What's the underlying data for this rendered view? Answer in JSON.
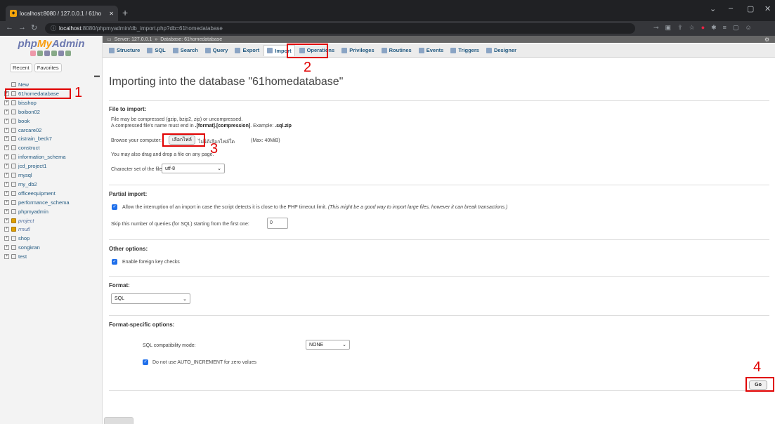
{
  "browser": {
    "tab_title": "localhost:8080 / 127.0.0.1 / 61ho",
    "new_tab": "+",
    "url_host": "localhost",
    "url_rest": ":8080/phpmyadmin/db_import.php?db=61homedatabase",
    "window_controls": [
      "⌄",
      "–",
      "▢",
      "✕"
    ]
  },
  "sidebar": {
    "logo_php": "php",
    "logo_my": "My",
    "logo_admin": "Admin",
    "recent": "Recent",
    "favorites": "Favorites",
    "databases": [
      {
        "name": "New",
        "italic": false
      },
      {
        "name": "61homedatabase",
        "italic": false
      },
      {
        "name": "bisshop",
        "italic": false
      },
      {
        "name": "boibon02",
        "italic": false
      },
      {
        "name": "book",
        "italic": false
      },
      {
        "name": "carcare02",
        "italic": false
      },
      {
        "name": "cistrain_beck7",
        "italic": false
      },
      {
        "name": "construct",
        "italic": false
      },
      {
        "name": "information_schema",
        "italic": false
      },
      {
        "name": "jcd_project1",
        "italic": false
      },
      {
        "name": "mysql",
        "italic": false
      },
      {
        "name": "my_db2",
        "italic": false
      },
      {
        "name": "officeequipment",
        "italic": false
      },
      {
        "name": "performance_schema",
        "italic": false
      },
      {
        "name": "phpmyadmin",
        "italic": false
      },
      {
        "name": "project",
        "italic": true
      },
      {
        "name": "rmutl",
        "italic": true
      },
      {
        "name": "shop",
        "italic": false
      },
      {
        "name": "songkran",
        "italic": false
      },
      {
        "name": "test",
        "italic": false
      }
    ]
  },
  "breadcrumb": {
    "server": "Server: 127.0.0.1",
    "sep": "»",
    "database": "Database: 61homedatabase"
  },
  "tabs": [
    {
      "label": "Structure",
      "active": false
    },
    {
      "label": "SQL",
      "active": false
    },
    {
      "label": "Search",
      "active": false
    },
    {
      "label": "Query",
      "active": false
    },
    {
      "label": "Export",
      "active": false
    },
    {
      "label": "Import",
      "active": true
    },
    {
      "label": "Operations",
      "active": false
    },
    {
      "label": "Privileges",
      "active": false
    },
    {
      "label": "Routines",
      "active": false
    },
    {
      "label": "Events",
      "active": false
    },
    {
      "label": "Triggers",
      "active": false
    },
    {
      "label": "Designer",
      "active": false
    }
  ],
  "main": {
    "title": "Importing into the database \"61homedatabase\"",
    "file_section": {
      "heading": "File to import:",
      "line1": "File may be compressed (gzip, bzip2, zip) or uncompressed.",
      "line2_a": "A compressed file's name must end in ",
      "line2_b": ".[format].[compression]",
      "line2_c": ". Example: ",
      "line2_d": ".sql.zip",
      "browse_label": "Browse your computer:",
      "choose_file_button": "เลือกไฟล์",
      "no_file_text": "ไม่ได้เลือกไฟล์ใด",
      "max_size": "(Max: 40MiB)",
      "drag_text": "You may also drag and drop a file on any page.",
      "charset_label": "Character set of the file:",
      "charset_value": "utf-8"
    },
    "partial_section": {
      "heading": "Partial import:",
      "allow_text": "Allow the interruption of an import in case the script detects it is close to the PHP timeout limit.",
      "allow_note": "(This might be a good way to import large files, however it can break transactions.)",
      "skip_label": "Skip this number of queries (for SQL) starting from the first one:",
      "skip_value": "0"
    },
    "other_section": {
      "heading": "Other options:",
      "fk_label": "Enable foreign key checks"
    },
    "format_section": {
      "heading": "Format:",
      "format_value": "SQL"
    },
    "format_specific": {
      "heading": "Format-specific options:",
      "compat_label": "SQL compatibility mode:",
      "compat_value": "NONE",
      "auto_inc_label": "Do not use AUTO_INCREMENT for zero values"
    },
    "go_button": "Go"
  },
  "annotations": {
    "labels": [
      "1",
      "2",
      "3",
      "4"
    ],
    "color": "#e00000"
  }
}
